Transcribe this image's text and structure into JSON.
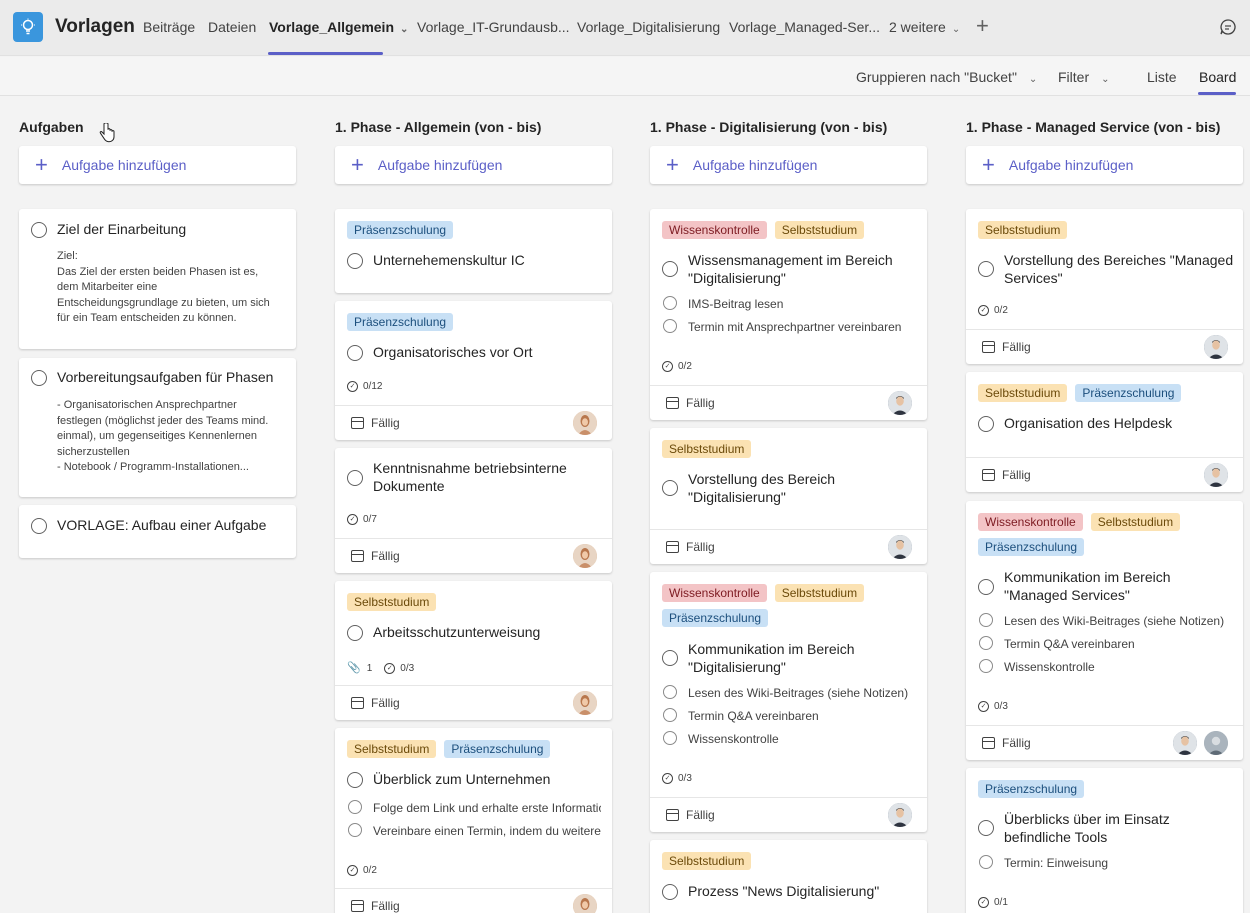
{
  "app": {
    "title": "Vorlagen"
  },
  "tabs": [
    {
      "label": "Beiträge"
    },
    {
      "label": "Dateien"
    },
    {
      "label": "Vorlage_Allgemein"
    },
    {
      "label": "Vorlage_IT-Grundausb..."
    },
    {
      "label": "Vorlage_Digitalisierung"
    },
    {
      "label": "Vorlage_Managed-Ser..."
    },
    {
      "label": "2 weitere"
    }
  ],
  "toolbar": {
    "group_label": "Gruppieren nach \"Bucket\"",
    "filter_label": "Filter",
    "list_label": "Liste",
    "board_label": "Board"
  },
  "labels": {
    "praesenz": "Präsenzschulung",
    "selbst": "Selbststudium",
    "wissen": "Wissenskontrolle",
    "due": "Fällig"
  },
  "add_task_label": "Aufgabe hinzufügen",
  "columns": [
    {
      "title": "Aufgaben",
      "cards": [
        {
          "title": "Ziel der Einarbeitung",
          "desc": [
            "Ziel:",
            "Das Ziel der ersten beiden Phasen ist es,",
            "dem Mitarbeiter eine",
            "Entscheidungsgrundlage zu bieten, um sich",
            "für ein Team entscheiden zu können."
          ]
        },
        {
          "title": "Vorbereitungsaufgaben für Phasen",
          "desc": [
            "- Organisatorischen Ansprechpartner",
            "festlegen (möglichst jeder des Teams mind.",
            "einmal), um gegenseitiges Kennenlernen",
            "sicherzustellen",
            "- Notebook / Programm-Installationen..."
          ]
        },
        {
          "title": "VORLAGE: Aufbau einer Aufgabe"
        }
      ]
    },
    {
      "title": "1. Phase - Allgemein (von - bis)",
      "cards": [
        {
          "title": "Unternehemenskultur IC"
        },
        {
          "title": "Organisatorisches vor Ort",
          "checklist": "0/12"
        },
        {
          "title": "Kenntnisnahme betriebsinterne Dokumente",
          "checklist": "0/7"
        },
        {
          "title": "Arbeitsschutzunterweisung",
          "attachments": "1",
          "checklist": "0/3"
        },
        {
          "title": "Überblick zum Unternehmen",
          "subtasks": [
            "Folge dem Link und erhalte erste Informatior",
            "Vereinbare einen Termin, indem du weitere D"
          ],
          "checklist": "0/2"
        }
      ]
    },
    {
      "title": "1. Phase - Digitalisierung (von - bis)",
      "cards": [
        {
          "title": "Wissensmanagement im Bereich \"Digitalisierung\"",
          "subtasks": [
            "IMS-Beitrag lesen",
            "Termin mit Ansprechpartner vereinbaren"
          ],
          "checklist": "0/2"
        },
        {
          "title": "Vorstellung des Bereich \"Digitalisierung\""
        },
        {
          "title": "Kommunikation im Bereich \"Digitalisierung\"",
          "subtasks": [
            "Lesen des Wiki-Beitrages (siehe Notizen)",
            "Termin Q&A vereinbaren",
            "Wissenskontrolle"
          ],
          "checklist": "0/3"
        },
        {
          "title": "Prozess \"News Digitalisierung\""
        }
      ]
    },
    {
      "title": "1. Phase - Managed Service (von - bis)",
      "cards": [
        {
          "title": "Vorstellung des Bereiches \"Managed Services\"",
          "checklist": "0/2"
        },
        {
          "title": "Organisation des Helpdesk"
        },
        {
          "title": "Kommunikation im Bereich \"Managed Services\"",
          "subtasks": [
            "Lesen des Wiki-Beitrages (siehe Notizen)",
            "Termin Q&A vereinbaren",
            "Wissenskontrolle"
          ],
          "checklist": "0/3"
        },
        {
          "title": "Überblicks über im Einsatz befindliche Tools",
          "subtasks": [
            "Termin: Einweisung"
          ],
          "checklist": "0/1"
        }
      ]
    }
  ]
}
